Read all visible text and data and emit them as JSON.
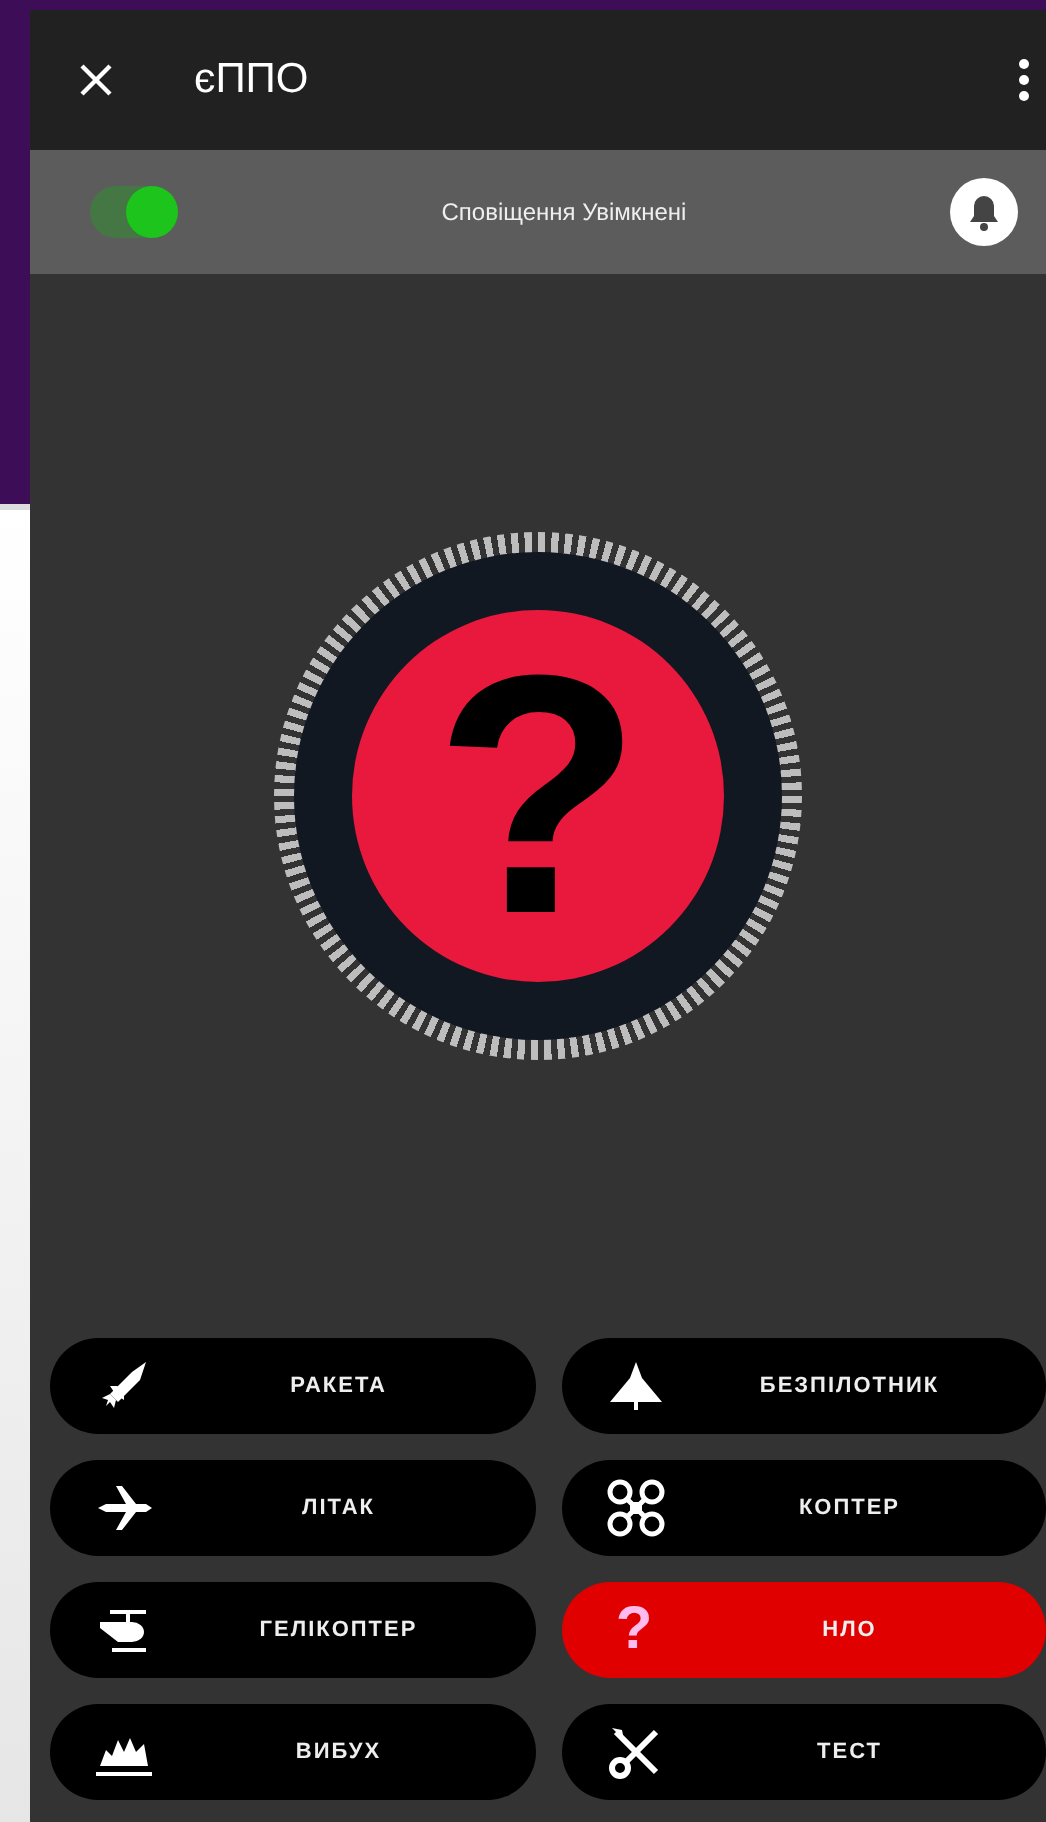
{
  "app_bar": {
    "title": "єППО"
  },
  "notification_bar": {
    "toggle_on": true,
    "text": "Сповіщення Увімкнені"
  },
  "status_symbol": "?",
  "buttons": [
    {
      "kind": "rocket",
      "label": "РАКЕТА",
      "selected": false
    },
    {
      "kind": "drone",
      "label": "БЕЗПІЛОТНИК",
      "selected": false
    },
    {
      "kind": "plane",
      "label": "ЛІТАК",
      "selected": false
    },
    {
      "kind": "quadcopter",
      "label": "КОПТЕР",
      "selected": false
    },
    {
      "kind": "helicopter",
      "label": "ГЕЛІКОПТЕР",
      "selected": false
    },
    {
      "kind": "unknown",
      "label": "НЛО",
      "selected": true,
      "symbol": "?"
    },
    {
      "kind": "explosion",
      "label": "ВИБУХ",
      "selected": false
    },
    {
      "kind": "tools",
      "label": "ТЕСТ",
      "selected": false
    }
  ]
}
